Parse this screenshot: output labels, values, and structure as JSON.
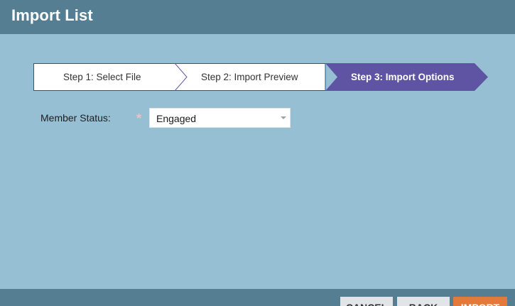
{
  "header": {
    "title": "Import List"
  },
  "steps": [
    {
      "label": "Step 1: Select File",
      "state": "complete"
    },
    {
      "label": "Step 2: Import Preview",
      "state": "complete"
    },
    {
      "label": "Step 3: Import Options",
      "state": "active"
    }
  ],
  "form": {
    "member_status": {
      "label": "Member Status:",
      "required_marker": "*",
      "value": "Engaged"
    }
  },
  "footer": {
    "cancel_label": "CANCEL",
    "back_label": "BACK",
    "import_label": "IMPORT"
  },
  "colors": {
    "header_bg": "#557e93",
    "body_bg": "#96bfd3",
    "active_step": "#5e54a3",
    "import_button": "#e47a3a"
  }
}
